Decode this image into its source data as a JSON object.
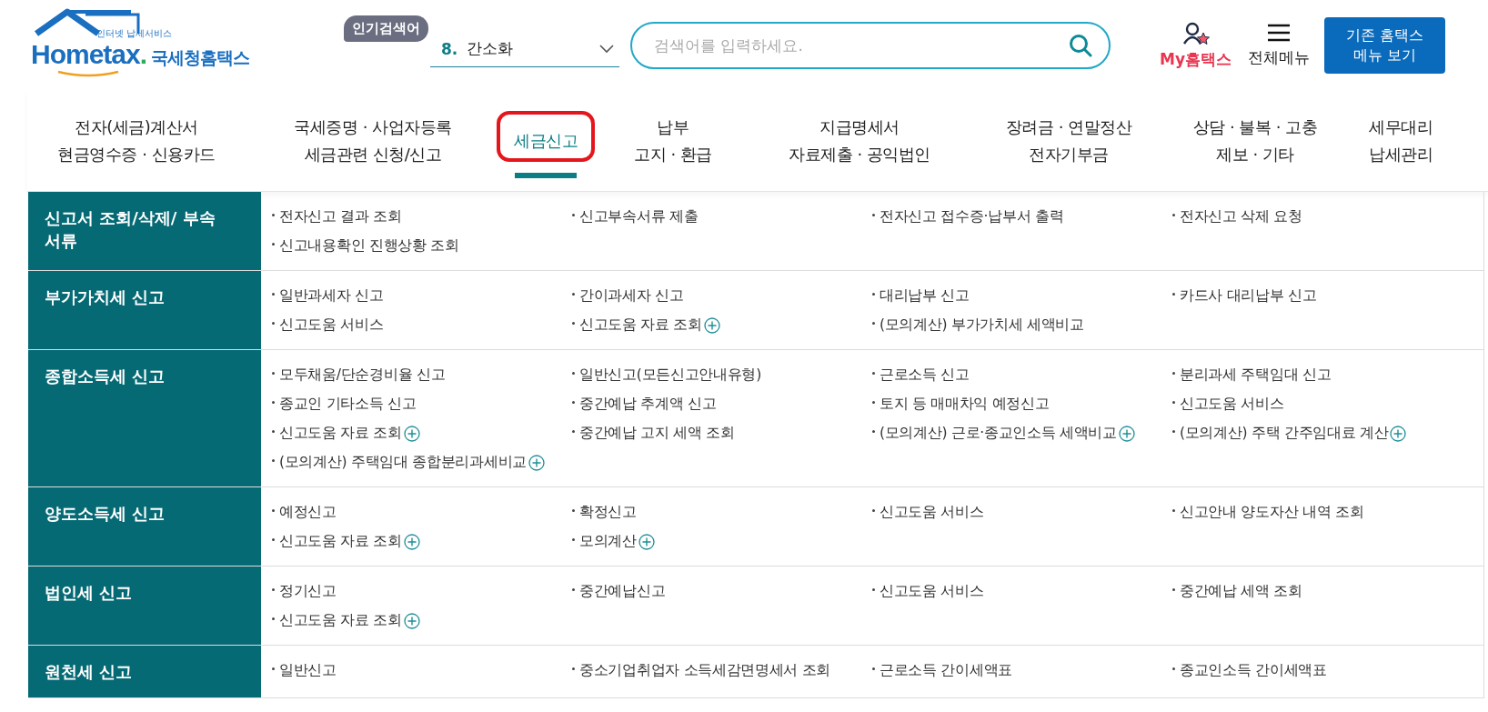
{
  "header": {
    "logo": {
      "tagline": "인터넷 납세서비스",
      "word": "Hometax",
      "dot": ".",
      "name": "국세청홈택스"
    },
    "popular": {
      "badge": "인기검색어",
      "rank": "8.",
      "term": "간소화"
    },
    "search": {
      "placeholder": "검색어를 입력하세요."
    },
    "my": {
      "label": "My홈택스"
    },
    "menu": {
      "label": "전체메뉴"
    },
    "legacy_button": {
      "lines": [
        "기존 홈택스",
        "메뉴 보기"
      ]
    }
  },
  "nav": [
    {
      "lines": [
        "전자(세금)계산서",
        "현금영수증 · 신용카드"
      ],
      "selected": false,
      "annotated": false
    },
    {
      "lines": [
        "국세증명 · 사업자등록",
        "세금관련 신청/신고"
      ],
      "selected": false,
      "annotated": false
    },
    {
      "lines": [
        "세금신고"
      ],
      "selected": true,
      "annotated": true
    },
    {
      "lines": [
        "납부",
        "고지 · 환급"
      ],
      "selected": false,
      "annotated": false
    },
    {
      "lines": [
        "지급명세서",
        "자료제출 · 공익법인"
      ],
      "selected": false,
      "annotated": false
    },
    {
      "lines": [
        "장려금 · 연말정산",
        "전자기부금"
      ],
      "selected": false,
      "annotated": false
    },
    {
      "lines": [
        "상담 · 불복 · 고충",
        "제보 · 기타"
      ],
      "selected": false,
      "annotated": false
    },
    {
      "lines": [
        "세무대리",
        "납세관리"
      ],
      "selected": false,
      "annotated": false
    }
  ],
  "sections": [
    {
      "title": "신고서 조회/삭제/ 부속서류",
      "items": [
        {
          "label": "전자신고 결과 조회",
          "expandable": false
        },
        {
          "label": "신고부속서류 제출",
          "expandable": false
        },
        {
          "label": "전자신고 접수증·납부서 출력",
          "expandable": false
        },
        {
          "label": "전자신고 삭제 요청",
          "expandable": false
        },
        {
          "label": "신고내용확인 진행상황 조회",
          "expandable": false
        }
      ]
    },
    {
      "title": "부가가치세 신고",
      "items": [
        {
          "label": "일반과세자 신고",
          "expandable": false
        },
        {
          "label": "간이과세자 신고",
          "expandable": false
        },
        {
          "label": "대리납부 신고",
          "expandable": false
        },
        {
          "label": "카드사 대리납부 신고",
          "expandable": false
        },
        {
          "label": "신고도움 서비스",
          "expandable": false
        },
        {
          "label": "신고도움 자료 조회",
          "expandable": true
        },
        {
          "label": "(모의계산) 부가가치세 세액비교",
          "expandable": false
        }
      ]
    },
    {
      "title": "종합소득세 신고",
      "items": [
        {
          "label": "모두채움/단순경비율 신고",
          "expandable": false
        },
        {
          "label": "일반신고(모든신고안내유형)",
          "expandable": false
        },
        {
          "label": "근로소득 신고",
          "expandable": false
        },
        {
          "label": "분리과세 주택임대 신고",
          "expandable": false
        },
        {
          "label": "종교인 기타소득 신고",
          "expandable": false
        },
        {
          "label": "중간예납 추계액 신고",
          "expandable": false
        },
        {
          "label": "토지 등 매매차익 예정신고",
          "expandable": false
        },
        {
          "label": "신고도움 서비스",
          "expandable": false
        },
        {
          "label": "신고도움 자료 조회",
          "expandable": true
        },
        {
          "label": "중간예납 고지 세액 조회",
          "expandable": false
        },
        {
          "label": "(모의계산) 근로·종교인소득 세액비교",
          "expandable": true
        },
        {
          "label": "(모의계산) 주택 간주임대료 계산",
          "expandable": true
        },
        {
          "label": "(모의계산) 주택임대 종합분리과세비교",
          "expandable": true
        }
      ]
    },
    {
      "title": "양도소득세 신고",
      "items": [
        {
          "label": "예정신고",
          "expandable": false
        },
        {
          "label": "확정신고",
          "expandable": false
        },
        {
          "label": "신고도움 서비스",
          "expandable": false
        },
        {
          "label": "신고안내 양도자산 내역 조회",
          "expandable": false
        },
        {
          "label": "신고도움 자료 조회",
          "expandable": true
        },
        {
          "label": "모의계산",
          "expandable": true
        }
      ]
    },
    {
      "title": "법인세 신고",
      "items": [
        {
          "label": "정기신고",
          "expandable": false
        },
        {
          "label": "중간예납신고",
          "expandable": false
        },
        {
          "label": "신고도움 서비스",
          "expandable": false
        },
        {
          "label": "중간예납 세액 조회",
          "expandable": false
        },
        {
          "label": "신고도움 자료 조회",
          "expandable": true
        }
      ]
    },
    {
      "title": "원천세 신고",
      "items": [
        {
          "label": "일반신고",
          "expandable": false
        },
        {
          "label": "중소기업취업자 소득세감면명세서 조회",
          "expandable": false
        },
        {
          "label": "근로소득 간이세액표",
          "expandable": false
        },
        {
          "label": "종교인소득 간이세액표",
          "expandable": false
        }
      ]
    }
  ]
}
